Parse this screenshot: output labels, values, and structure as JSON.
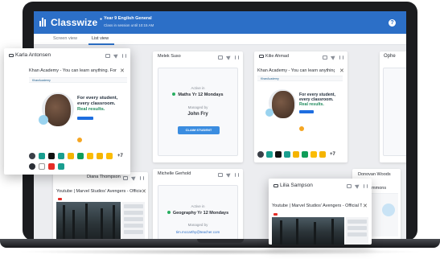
{
  "app": {
    "brand": "Classwize",
    "class_name": "Year 9 English General",
    "class_status": "Class in session until 10:15 AM",
    "help_glyph": "?"
  },
  "tabs": [
    {
      "label": "Screen view",
      "active": false
    },
    {
      "label": "List view",
      "active": true
    }
  ],
  "students": {
    "karla": {
      "name": "Karla Antonsen",
      "tab_title": "Khan Academy - You can learn anything. For fr...",
      "site_logo": "KhanAcademy",
      "tagline": [
        "For every student,",
        "every classroom.",
        "Real results."
      ],
      "extra_tabs": "+7"
    },
    "melek": {
      "name": "Melek Suso",
      "active_in_label": "Active in",
      "active_class": "Maths Yr 12 Mondays",
      "managed_by_label": "Managed by",
      "manager": "John Fry",
      "claim_label": "CLAIM STUDENT"
    },
    "kilie": {
      "name": "Kilie Ahmad",
      "tab_title": "Khan Academy - You can learn anything. For fr...",
      "site_logo": "KhanAcademy",
      "tagline": [
        "For every student,",
        "every classroom.",
        "Real results."
      ],
      "extra_tabs": "+7"
    },
    "ophe": {
      "name": "Ophe"
    },
    "diana": {
      "name": "Diana Thompson",
      "tab_title": "Youtube | Marvel Studios' Avengers - Official Tr..."
    },
    "michelle": {
      "name": "Michelle Gerhold",
      "active_in_label": "Active in",
      "active_class": "Geography Yr 12 Mondays",
      "managed_by_label": "Managed by",
      "manager": "tim.mccarthy@teacher.com"
    },
    "lilia": {
      "name": "Lilia Sampson",
      "tab_title": "Youtube | Marvel Studios' Avengers - Official Tr..."
    },
    "donovan": {
      "name": "Donovan Woods",
      "tab_title": "ommons"
    }
  },
  "colors": {
    "brand_blue": "#2c6fc7",
    "claim_blue": "#3b8de0",
    "active_green": "#27ae60",
    "accent_orange": "#f5a623"
  },
  "icons": [
    "laptop-icon",
    "screen-icon",
    "send-icon",
    "pause-icon",
    "close-icon",
    "help-icon"
  ]
}
